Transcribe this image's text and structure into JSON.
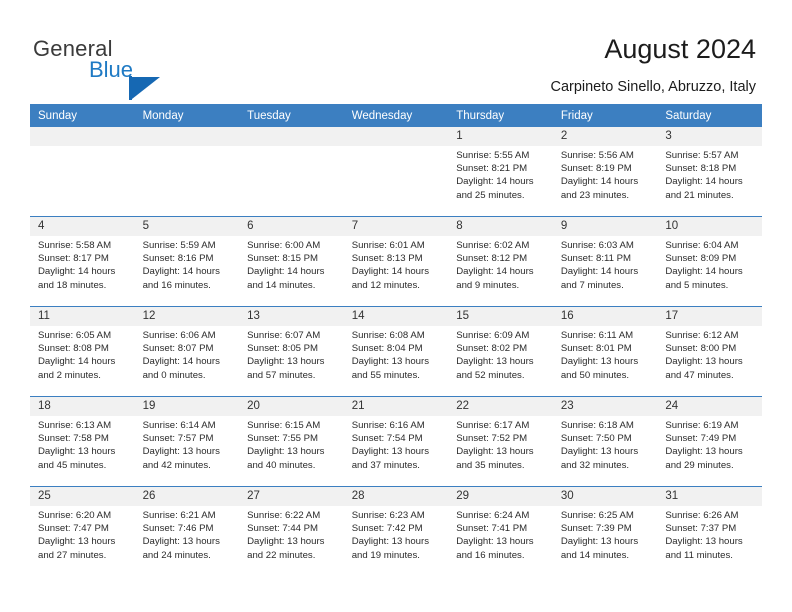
{
  "brand": {
    "name_part1": "General",
    "name_part2": "Blue",
    "flag_color": "#1668b3",
    "blue_color": "#1f7ac4"
  },
  "header": {
    "title": "August 2024",
    "location": "Carpineto Sinello, Abruzzo, Italy"
  },
  "theme": {
    "header_bar": "#3c7fc1",
    "daynum_band": "#f1f1f1",
    "text": "#2b2b2b"
  },
  "calendar": {
    "weekday_headers": [
      "Sunday",
      "Monday",
      "Tuesday",
      "Wednesday",
      "Thursday",
      "Friday",
      "Saturday"
    ],
    "weeks": [
      [
        {
          "day": "",
          "lines": []
        },
        {
          "day": "",
          "lines": []
        },
        {
          "day": "",
          "lines": []
        },
        {
          "day": "",
          "lines": []
        },
        {
          "day": "1",
          "lines": [
            "Sunrise: 5:55 AM",
            "Sunset: 8:21 PM",
            "Daylight: 14 hours",
            "and 25 minutes."
          ]
        },
        {
          "day": "2",
          "lines": [
            "Sunrise: 5:56 AM",
            "Sunset: 8:19 PM",
            "Daylight: 14 hours",
            "and 23 minutes."
          ]
        },
        {
          "day": "3",
          "lines": [
            "Sunrise: 5:57 AM",
            "Sunset: 8:18 PM",
            "Daylight: 14 hours",
            "and 21 minutes."
          ]
        }
      ],
      [
        {
          "day": "4",
          "lines": [
            "Sunrise: 5:58 AM",
            "Sunset: 8:17 PM",
            "Daylight: 14 hours",
            "and 18 minutes."
          ]
        },
        {
          "day": "5",
          "lines": [
            "Sunrise: 5:59 AM",
            "Sunset: 8:16 PM",
            "Daylight: 14 hours",
            "and 16 minutes."
          ]
        },
        {
          "day": "6",
          "lines": [
            "Sunrise: 6:00 AM",
            "Sunset: 8:15 PM",
            "Daylight: 14 hours",
            "and 14 minutes."
          ]
        },
        {
          "day": "7",
          "lines": [
            "Sunrise: 6:01 AM",
            "Sunset: 8:13 PM",
            "Daylight: 14 hours",
            "and 12 minutes."
          ]
        },
        {
          "day": "8",
          "lines": [
            "Sunrise: 6:02 AM",
            "Sunset: 8:12 PM",
            "Daylight: 14 hours",
            "and 9 minutes."
          ]
        },
        {
          "day": "9",
          "lines": [
            "Sunrise: 6:03 AM",
            "Sunset: 8:11 PM",
            "Daylight: 14 hours",
            "and 7 minutes."
          ]
        },
        {
          "day": "10",
          "lines": [
            "Sunrise: 6:04 AM",
            "Sunset: 8:09 PM",
            "Daylight: 14 hours",
            "and 5 minutes."
          ]
        }
      ],
      [
        {
          "day": "11",
          "lines": [
            "Sunrise: 6:05 AM",
            "Sunset: 8:08 PM",
            "Daylight: 14 hours",
            "and 2 minutes."
          ]
        },
        {
          "day": "12",
          "lines": [
            "Sunrise: 6:06 AM",
            "Sunset: 8:07 PM",
            "Daylight: 14 hours",
            "and 0 minutes."
          ]
        },
        {
          "day": "13",
          "lines": [
            "Sunrise: 6:07 AM",
            "Sunset: 8:05 PM",
            "Daylight: 13 hours",
            "and 57 minutes."
          ]
        },
        {
          "day": "14",
          "lines": [
            "Sunrise: 6:08 AM",
            "Sunset: 8:04 PM",
            "Daylight: 13 hours",
            "and 55 minutes."
          ]
        },
        {
          "day": "15",
          "lines": [
            "Sunrise: 6:09 AM",
            "Sunset: 8:02 PM",
            "Daylight: 13 hours",
            "and 52 minutes."
          ]
        },
        {
          "day": "16",
          "lines": [
            "Sunrise: 6:11 AM",
            "Sunset: 8:01 PM",
            "Daylight: 13 hours",
            "and 50 minutes."
          ]
        },
        {
          "day": "17",
          "lines": [
            "Sunrise: 6:12 AM",
            "Sunset: 8:00 PM",
            "Daylight: 13 hours",
            "and 47 minutes."
          ]
        }
      ],
      [
        {
          "day": "18",
          "lines": [
            "Sunrise: 6:13 AM",
            "Sunset: 7:58 PM",
            "Daylight: 13 hours",
            "and 45 minutes."
          ]
        },
        {
          "day": "19",
          "lines": [
            "Sunrise: 6:14 AM",
            "Sunset: 7:57 PM",
            "Daylight: 13 hours",
            "and 42 minutes."
          ]
        },
        {
          "day": "20",
          "lines": [
            "Sunrise: 6:15 AM",
            "Sunset: 7:55 PM",
            "Daylight: 13 hours",
            "and 40 minutes."
          ]
        },
        {
          "day": "21",
          "lines": [
            "Sunrise: 6:16 AM",
            "Sunset: 7:54 PM",
            "Daylight: 13 hours",
            "and 37 minutes."
          ]
        },
        {
          "day": "22",
          "lines": [
            "Sunrise: 6:17 AM",
            "Sunset: 7:52 PM",
            "Daylight: 13 hours",
            "and 35 minutes."
          ]
        },
        {
          "day": "23",
          "lines": [
            "Sunrise: 6:18 AM",
            "Sunset: 7:50 PM",
            "Daylight: 13 hours",
            "and 32 minutes."
          ]
        },
        {
          "day": "24",
          "lines": [
            "Sunrise: 6:19 AM",
            "Sunset: 7:49 PM",
            "Daylight: 13 hours",
            "and 29 minutes."
          ]
        }
      ],
      [
        {
          "day": "25",
          "lines": [
            "Sunrise: 6:20 AM",
            "Sunset: 7:47 PM",
            "Daylight: 13 hours",
            "and 27 minutes."
          ]
        },
        {
          "day": "26",
          "lines": [
            "Sunrise: 6:21 AM",
            "Sunset: 7:46 PM",
            "Daylight: 13 hours",
            "and 24 minutes."
          ]
        },
        {
          "day": "27",
          "lines": [
            "Sunrise: 6:22 AM",
            "Sunset: 7:44 PM",
            "Daylight: 13 hours",
            "and 22 minutes."
          ]
        },
        {
          "day": "28",
          "lines": [
            "Sunrise: 6:23 AM",
            "Sunset: 7:42 PM",
            "Daylight: 13 hours",
            "and 19 minutes."
          ]
        },
        {
          "day": "29",
          "lines": [
            "Sunrise: 6:24 AM",
            "Sunset: 7:41 PM",
            "Daylight: 13 hours",
            "and 16 minutes."
          ]
        },
        {
          "day": "30",
          "lines": [
            "Sunrise: 6:25 AM",
            "Sunset: 7:39 PM",
            "Daylight: 13 hours",
            "and 14 minutes."
          ]
        },
        {
          "day": "31",
          "lines": [
            "Sunrise: 6:26 AM",
            "Sunset: 7:37 PM",
            "Daylight: 13 hours",
            "and 11 minutes."
          ]
        }
      ]
    ]
  }
}
